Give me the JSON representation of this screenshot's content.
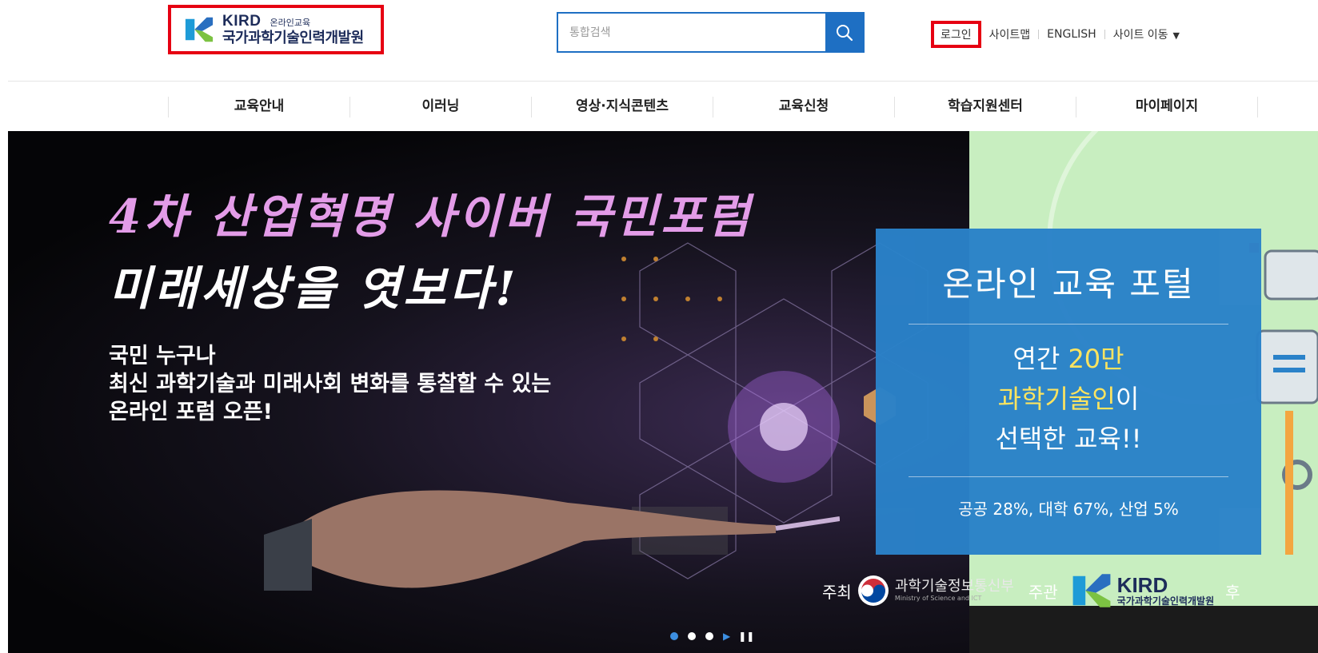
{
  "header": {
    "logo": {
      "brand": "KIRD",
      "sub": "온라인교육",
      "name": "국가과학기술인력개발원"
    },
    "search": {
      "placeholder": "통합검색",
      "button_icon": "search-icon"
    },
    "util_links": [
      {
        "label": "로그인"
      },
      {
        "label": "사이트맵"
      },
      {
        "label": "ENGLISH"
      },
      {
        "label": "사이트 이동"
      }
    ],
    "site_move_icon": "caret-down-icon"
  },
  "gnb": {
    "items": [
      "교육안내",
      "이러닝",
      "영상·지식콘텐츠",
      "교육신청",
      "학습지원센터",
      "마이페이지"
    ]
  },
  "banner": {
    "headline_1": "4차 산업혁명 사이버 국민포럼",
    "headline_2": "미래세상을 엿보다!",
    "subcopy_1": "국민 누구나",
    "subcopy_2": "최신 과학기술과 미래사회 변화를 통찰할 수 있는",
    "subcopy_3": "온라인 포럼 오픈!",
    "host_label": "주최",
    "host_org": "과학기술정보통신부",
    "host_org_eng": "Ministry of Science and ICT",
    "organizer_label": "주관",
    "organizer_brand": "KIRD",
    "organizer_name": "국가과학기술인력개발원",
    "extra_label": "후",
    "pager": {
      "slides": 3,
      "active": 0
    }
  },
  "portal": {
    "title": "온라인 교육 포털",
    "line1_prefix": "연간 ",
    "line1_highlight": "20만",
    "line2_highlight": "과학기술인",
    "line2_suffix": "이",
    "line3": "선택한 교육!!",
    "stats": "공공 28%, 대학 67%, 산업 5%",
    "highlight_color": "#ffe45c",
    "bg_color": "#2a82c9"
  },
  "colors": {
    "accent": "#1e6fc3",
    "annotation_red": "#e60012",
    "brand_navy": "#1d2c5a"
  }
}
